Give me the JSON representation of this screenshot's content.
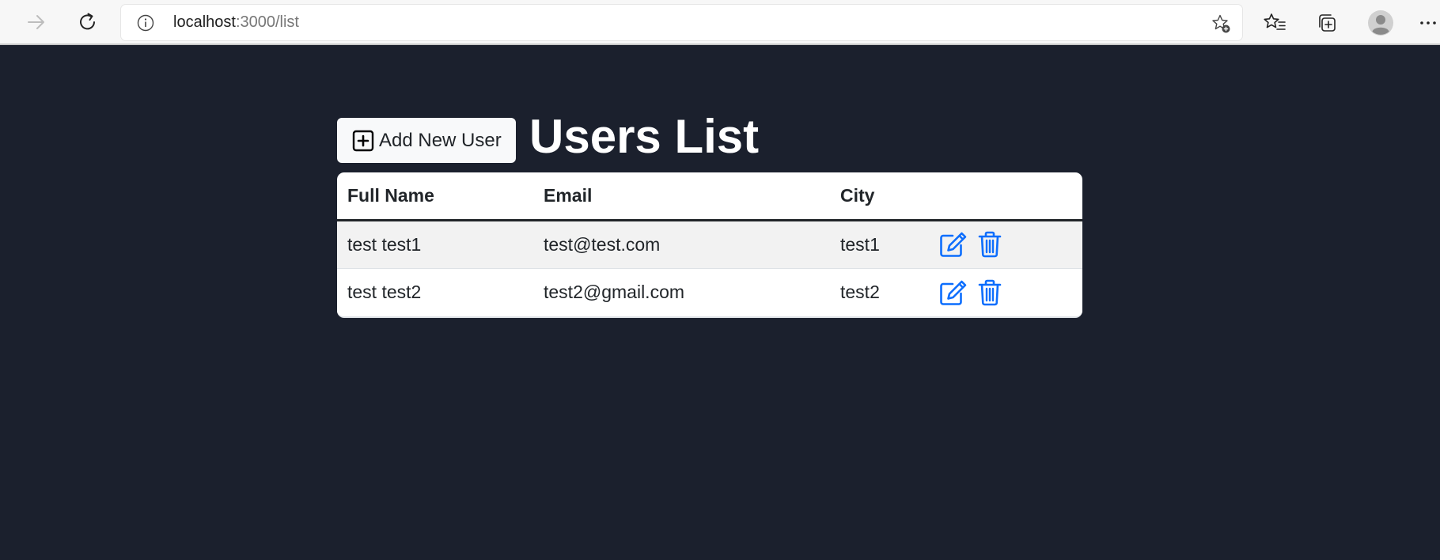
{
  "browser": {
    "url_host": "localhost",
    "url_path": ":3000/list"
  },
  "page": {
    "title": "Users List",
    "add_button_label": "Add New User"
  },
  "table": {
    "columns": [
      "Full Name",
      "Email",
      "City",
      ""
    ],
    "rows": [
      {
        "full_name": "test test1",
        "email": "test@test.com",
        "city": "test1"
      },
      {
        "full_name": "test test2",
        "email": "test2@gmail.com",
        "city": "test2"
      }
    ]
  },
  "icons": {
    "back": "arrow-right-icon",
    "refresh": "refresh-icon",
    "info": "info-icon",
    "add_favorite": "star-plus-icon",
    "favorites": "favorites-list-icon",
    "collections": "collections-icon",
    "profile": "avatar",
    "more": "more-dots-icon",
    "add": "plus-square-icon",
    "edit": "edit-icon",
    "delete": "trash-icon"
  },
  "colors": {
    "page_background": "#1b202d",
    "action_icon": "#0d6efd",
    "row_striped": "#f2f2f2"
  }
}
